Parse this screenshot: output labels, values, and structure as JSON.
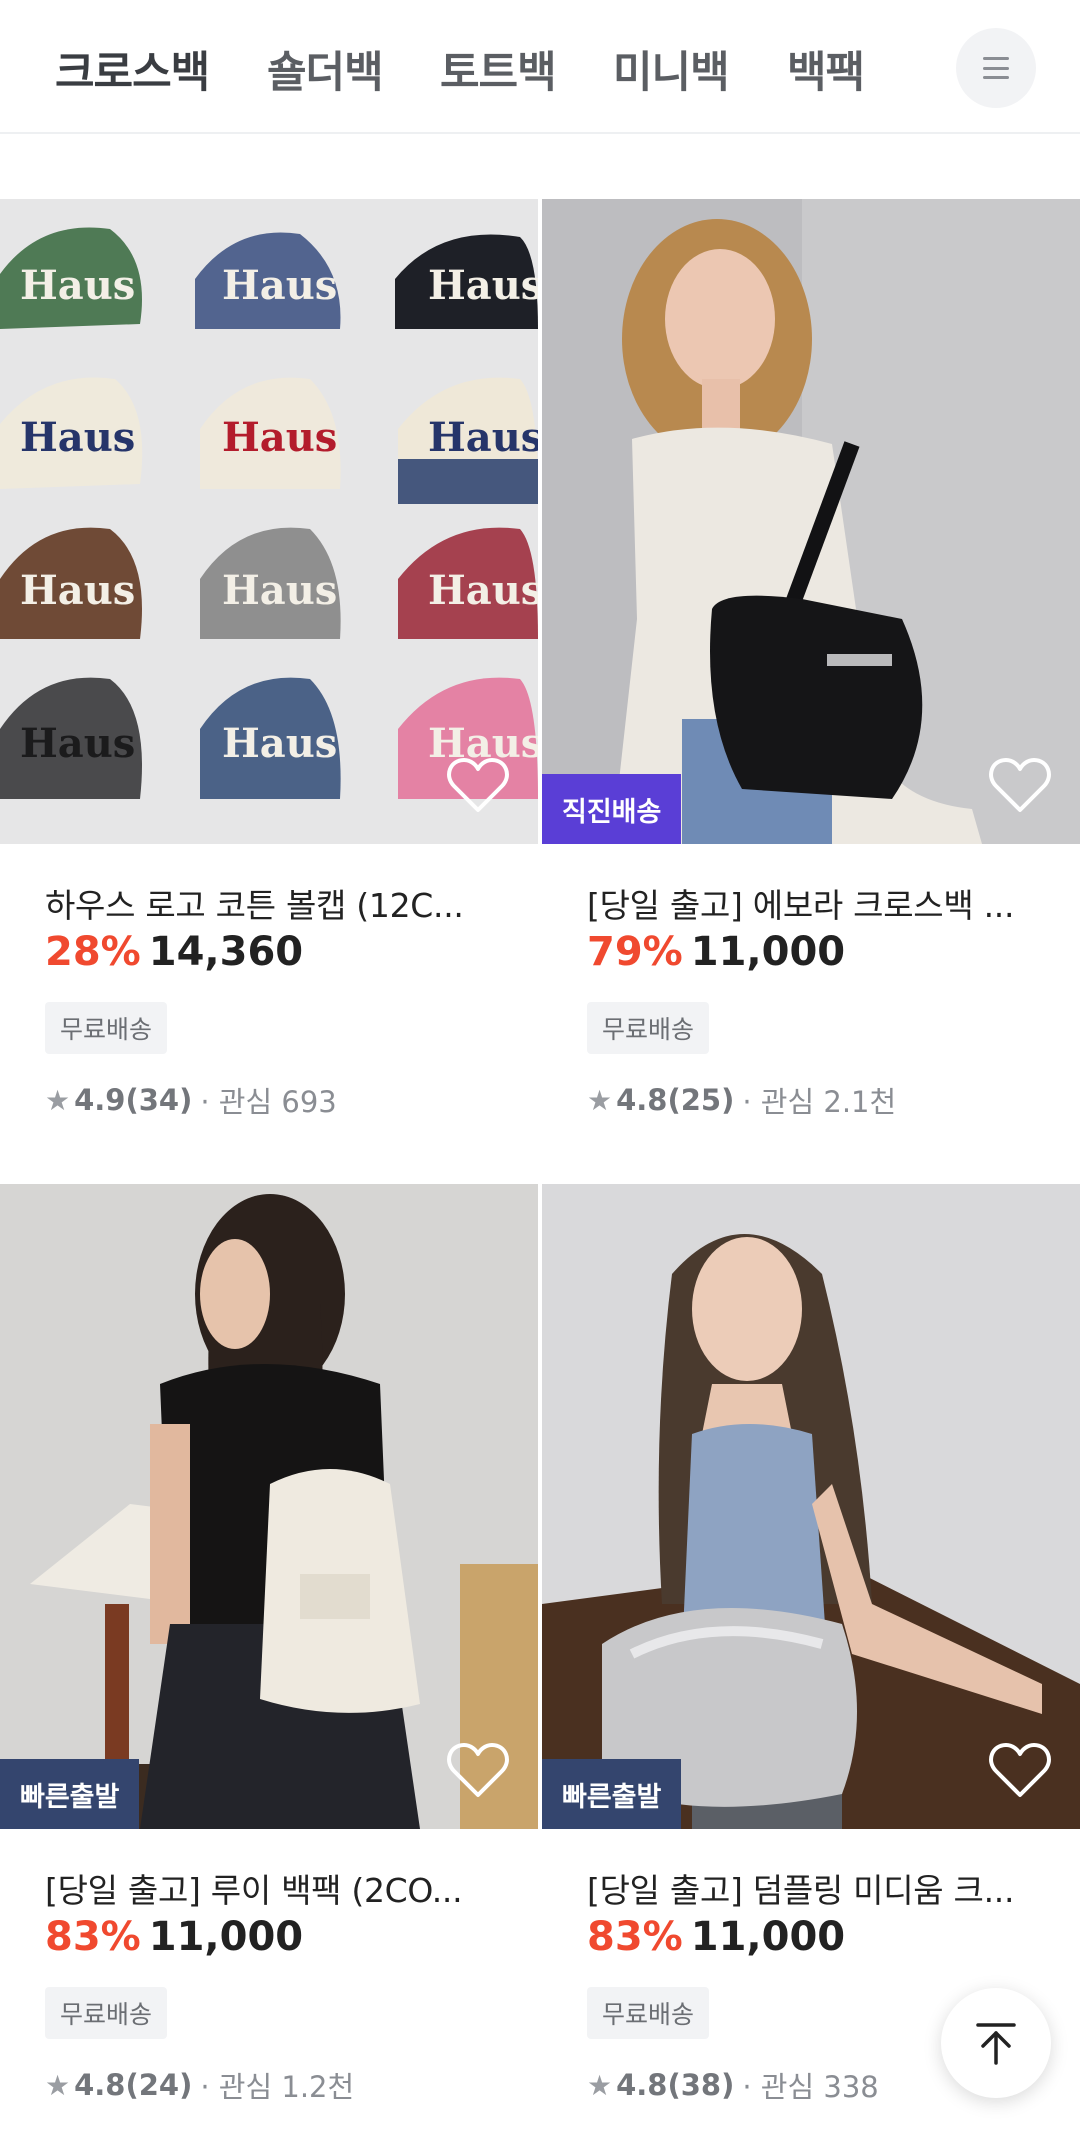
{
  "category_tabs": [
    {
      "label": "크로스백"
    },
    {
      "label": "숄더백"
    },
    {
      "label": "토트백"
    },
    {
      "label": "미니백"
    },
    {
      "label": "백팩"
    }
  ],
  "menu_icon": "menu-icon",
  "products": [
    {
      "title": "하우스 로고 코튼 볼캡 (12C...",
      "discount": "28%",
      "price": "14,360",
      "shipping_tag": "무료배송",
      "rating": "4.9",
      "reviews": "(34)",
      "interest": "· 관심 693",
      "badge": "",
      "image_text": "Haus"
    },
    {
      "title": "[당일 출고] 에보라 크로스백 ...",
      "discount": "79%",
      "price": "11,000",
      "shipping_tag": "무료배송",
      "rating": "4.8",
      "reviews": "(25)",
      "interest": "· 관심 2.1천",
      "badge": "직진배송"
    },
    {
      "title": "[당일 출고] 루이 백팩 (2CO...",
      "discount": "83%",
      "price": "11,000",
      "shipping_tag": "무료배송",
      "rating": "4.8",
      "reviews": "(24)",
      "interest": "· 관심 1.2천",
      "badge": "빠른출발"
    },
    {
      "title": "[당일 출고] 덤플링 미디움 크...",
      "discount": "83%",
      "price": "11,000",
      "shipping_tag": "무료배송",
      "rating": "4.8",
      "reviews": "(38)",
      "interest": "· 관심 338",
      "badge": "빠른출발"
    }
  ],
  "colors": {
    "discount": "#f0492f",
    "badge_purple": "#5a3ed6",
    "badge_navy": "#34456e"
  },
  "scroll_top_icon": "arrow-up-to-top-icon"
}
